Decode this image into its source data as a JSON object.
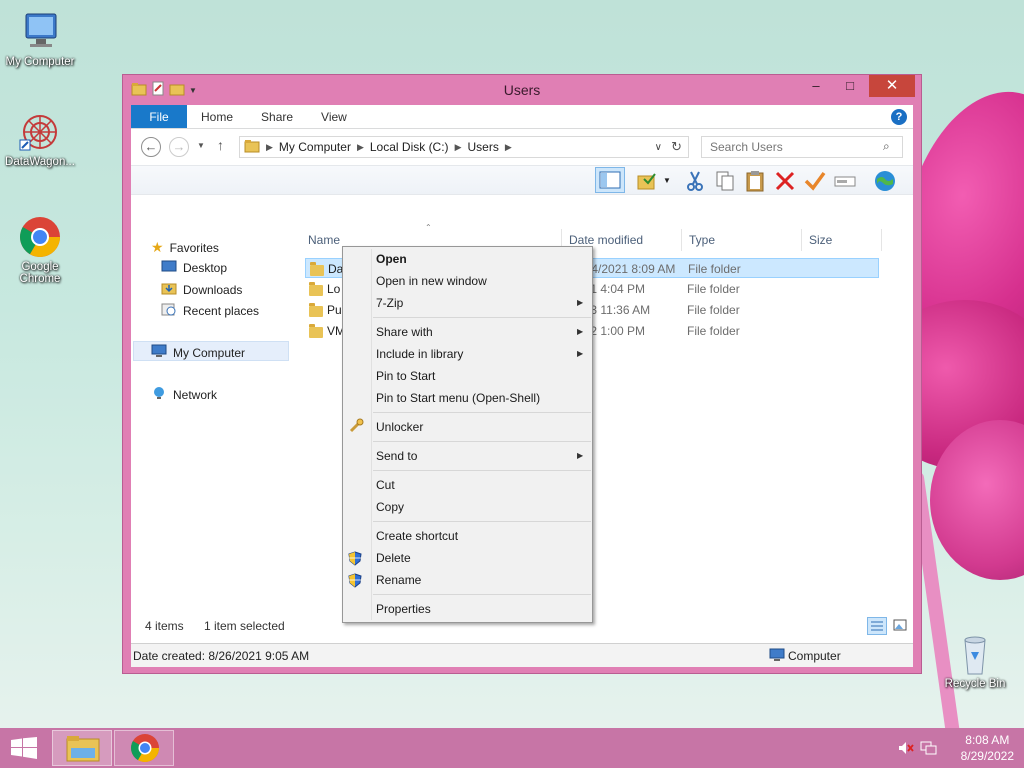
{
  "desktop": {
    "icons": [
      {
        "label": "My Computer"
      },
      {
        "label": "DataWagon..."
      },
      {
        "label": "Google Chrome"
      },
      {
        "label": "Recycle Bin"
      }
    ]
  },
  "window": {
    "title": "Users",
    "minimize": "–",
    "maximize": "□",
    "close": "✕"
  },
  "ribbon": {
    "tabs": [
      "File",
      "Home",
      "Share",
      "View"
    ],
    "help": "?"
  },
  "address": {
    "crumbs": [
      "My Computer",
      "Local Disk (C:)",
      "Users"
    ],
    "search_placeholder": "Search Users"
  },
  "nav": {
    "favorites": "Favorites",
    "desktop": "Desktop",
    "downloads": "Downloads",
    "recent": "Recent places",
    "computer": "My Computer",
    "network": "Network"
  },
  "columns": [
    "Name",
    "Date modified",
    "Type",
    "Size"
  ],
  "rows": [
    {
      "name": "Dartz",
      "date": "12/24/2021 8:09 AM",
      "type": "File folder"
    },
    {
      "name": "Lo",
      "date": "/2021 4:04 PM",
      "type": "File folder"
    },
    {
      "name": "Pu",
      "date": "/2013 11:36 AM",
      "type": "File folder"
    },
    {
      "name": "VM",
      "date": "/2022 1:00 PM",
      "type": "File folder"
    }
  ],
  "status": {
    "items": "4 items",
    "selected": "1 item selected",
    "date_created": "Date created: 8/26/2021 9:05 AM",
    "location": "Computer"
  },
  "context_menu": {
    "open": "Open",
    "open_new_window": "Open in new window",
    "zip": "7-Zip",
    "share_with": "Share with",
    "include_library": "Include in library",
    "pin_start": "Pin to Start",
    "pin_start_menu": "Pin to Start menu (Open-Shell)",
    "unlocker": "Unlocker",
    "send_to": "Send to",
    "cut": "Cut",
    "copy": "Copy",
    "create_shortcut": "Create shortcut",
    "delete": "Delete",
    "rename": "Rename",
    "properties": "Properties"
  },
  "taskbar": {
    "time": "8:08 AM",
    "date": "8/29/2022"
  }
}
